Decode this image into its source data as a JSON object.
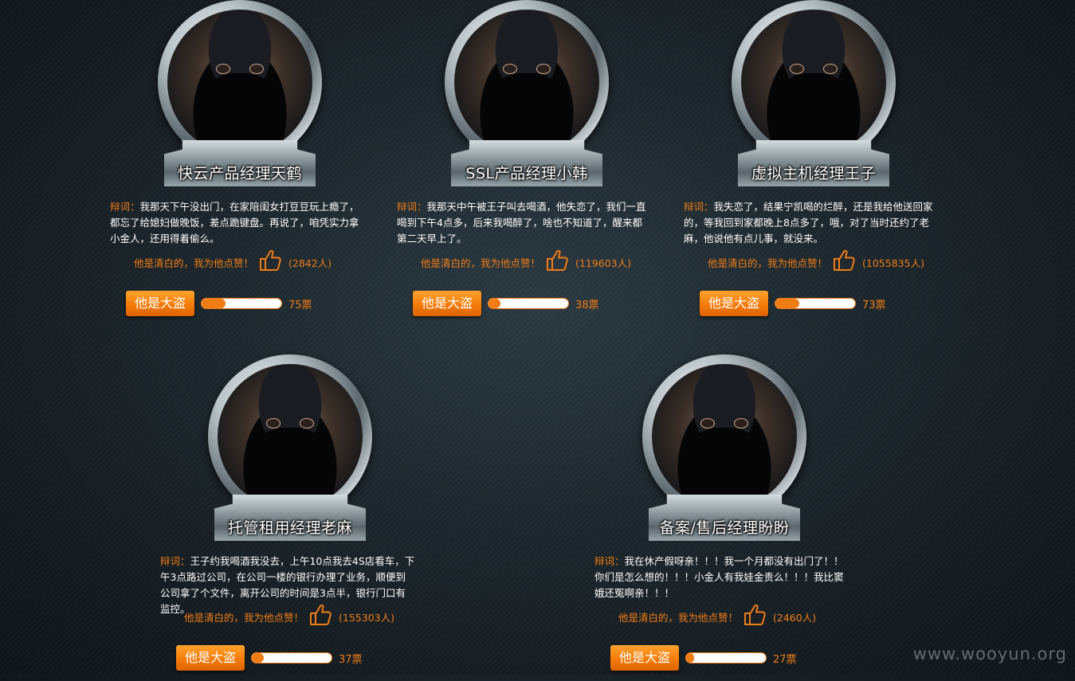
{
  "defense_label": "辩词：",
  "like_text": "他是清白的，我为他点赞！",
  "vote_label": "他是大盗",
  "accent_color": "#f07c16",
  "suspects": [
    {
      "name": "快云产品经理天鹤",
      "defense": "我那天下午没出门，在家陪闺女打豆豆玩上瘾了，都忘了给媳妇做晚饭，差点跪键盘。再说了，咱凭实力拿小金人，还用得着偷么。",
      "likes": "(2842人)",
      "votes": "75票",
      "vote_fraction": 0.3
    },
    {
      "name": "SSL产品经理小韩",
      "defense": "我那天中午被王子叫去喝酒，他失恋了，我们一直喝到下午4点多，后来我喝醉了，啥也不知道了，醒来都第二天早上了。",
      "likes": "(119603人)",
      "votes": "38票",
      "vote_fraction": 0.15
    },
    {
      "name": "虚拟主机经理王子",
      "defense": "我失恋了，结果宁凯喝的烂醉，还是我给他送回家的，等我回到家都晚上8点多了，哦，对了当时还约了老麻，他说他有点儿事，就没来。",
      "likes": "(1055835人)",
      "votes": "73票",
      "vote_fraction": 0.3
    },
    {
      "name": "托管租用经理老麻",
      "defense": "王子约我喝酒我没去，上午10点我去4S店看车，下午3点路过公司，在公司一楼的银行办理了业务，顺便到公司拿了个文件，离开公司的时间是3点半，银行门口有监控。",
      "likes": "(155303人)",
      "votes": "37票",
      "vote_fraction": 0.15
    },
    {
      "name": "备案/售后经理盼盼",
      "defense": "我在休产假呀亲！！！我一个月都没有出门了！！你们是怎么想的！！！小金人有我娃金贵么！！！我比窦娥还冤啊亲！！！",
      "likes": "(2460人)",
      "votes": "27票",
      "vote_fraction": 0.1
    }
  ],
  "watermark": "www.wooyun.org"
}
